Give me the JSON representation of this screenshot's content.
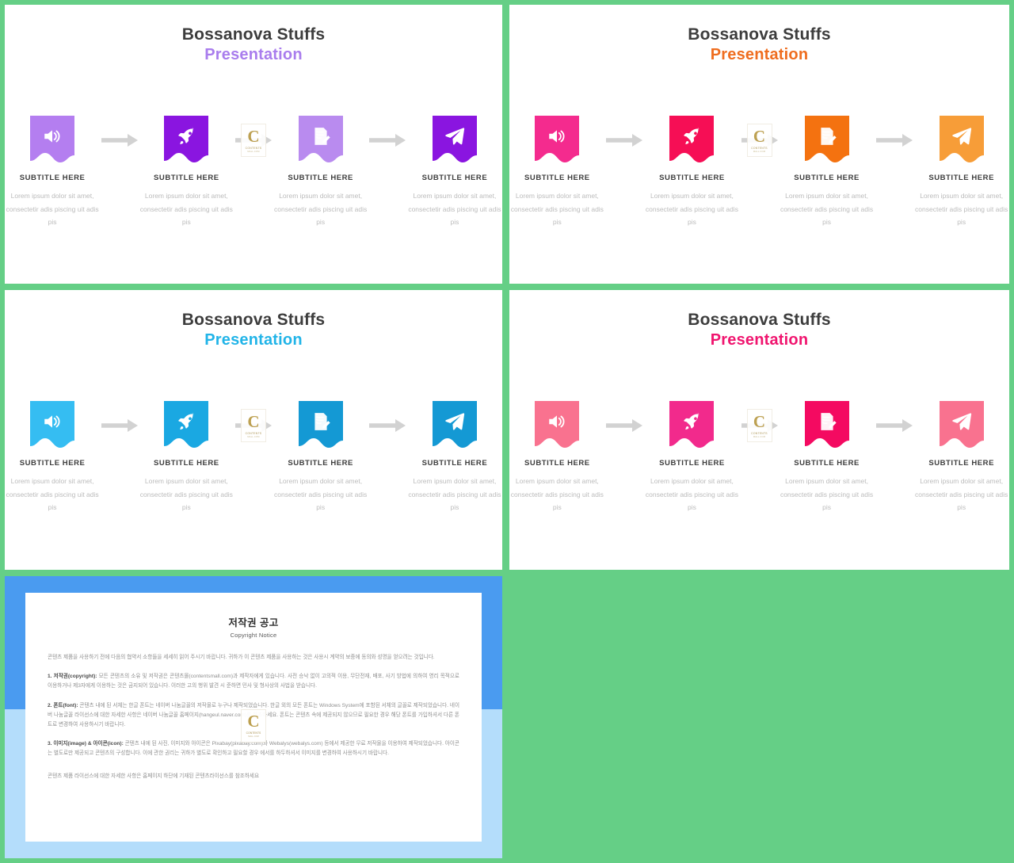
{
  "background_color": "#65cf86",
  "slides": [
    {
      "id": "slide-1",
      "title_line1": "Bossanova Stuffs",
      "title_line2": "Presentation",
      "accent": "#a97ded",
      "ribbon_colors": [
        "#b47ef0",
        "#8a15e0",
        "#b98bef",
        "#8a15e0"
      ],
      "steps": [
        {
          "icon": "speaker-icon",
          "title": "SUBTITLE HERE",
          "body": "Lorem ipsum dolor sit amet, consectetir adis piscing uit adis pis"
        },
        {
          "icon": "rocket-icon",
          "title": "SUBTITLE HERE",
          "body": "Lorem ipsum dolor sit amet, consectetir adis piscing uit adis pis"
        },
        {
          "icon": "note-edit-icon",
          "title": "SUBTITLE HERE",
          "body": "Lorem ipsum dolor sit amet, consectetir adis piscing uit adis pis"
        },
        {
          "icon": "paper-plane-icon",
          "title": "SUBTITLE HERE",
          "body": "Lorem ipsum dolor sit amet, consectetir adis piscing uit adis pis"
        }
      ]
    },
    {
      "id": "slide-2",
      "title_line1": "Bossanova Stuffs",
      "title_line2": "Presentation",
      "accent": "#ef6d1f",
      "ribbon_colors": [
        "#f42b8e",
        "#f60e55",
        "#f47210",
        "#f79d38"
      ],
      "steps": [
        {
          "icon": "speaker-icon",
          "title": "SUBTITLE HERE",
          "body": "Lorem ipsum dolor sit amet, consectetir adis piscing uit adis pis"
        },
        {
          "icon": "rocket-icon",
          "title": "SUBTITLE HERE",
          "body": "Lorem ipsum dolor sit amet, consectetir adis piscing uit adis pis"
        },
        {
          "icon": "note-edit-icon",
          "title": "SUBTITLE HERE",
          "body": "Lorem ipsum dolor sit amet, consectetir adis piscing uit adis pis"
        },
        {
          "icon": "paper-plane-icon",
          "title": "SUBTITLE HERE",
          "body": "Lorem ipsum dolor sit amet, consectetir adis piscing uit adis pis"
        }
      ]
    },
    {
      "id": "slide-3",
      "title_line1": "Bossanova Stuffs",
      "title_line2": "Presentation",
      "accent": "#21b4e8",
      "ribbon_colors": [
        "#35bdf2",
        "#1aa8e2",
        "#1499d4",
        "#1499d4"
      ],
      "steps": [
        {
          "icon": "speaker-icon",
          "title": "SUBTITLE HERE",
          "body": "Lorem ipsum dolor sit amet, consectetir adis piscing uit adis pis"
        },
        {
          "icon": "rocket-icon",
          "title": "SUBTITLE HERE",
          "body": "Lorem ipsum dolor sit amet, consectetir adis piscing uit adis pis"
        },
        {
          "icon": "note-edit-icon",
          "title": "SUBTITLE HERE",
          "body": "Lorem ipsum dolor sit amet, consectetir adis piscing uit adis pis"
        },
        {
          "icon": "paper-plane-icon",
          "title": "SUBTITLE HERE",
          "body": "Lorem ipsum dolor sit amet, consectetir adis piscing uit adis pis"
        }
      ]
    },
    {
      "id": "slide-4",
      "title_line1": "Bossanova Stuffs",
      "title_line2": "Presentation",
      "accent": "#f0156f",
      "ribbon_colors": [
        "#f9728f",
        "#f22a8c",
        "#f40a61",
        "#f9728f"
      ],
      "steps": [
        {
          "icon": "speaker-icon",
          "title": "SUBTITLE HERE",
          "body": "Lorem ipsum dolor sit amet, consectetir adis piscing uit adis pis"
        },
        {
          "icon": "rocket-icon",
          "title": "SUBTITLE HERE",
          "body": "Lorem ipsum dolor sit amet, consectetir adis piscing uit adis pis"
        },
        {
          "icon": "note-edit-icon",
          "title": "SUBTITLE HERE",
          "body": "Lorem ipsum dolor sit amet, consectetir adis piscing uit adis pis"
        },
        {
          "icon": "paper-plane-icon",
          "title": "SUBTITLE HERE",
          "body": "Lorem ipsum dolor sit amet, consectetir adis piscing uit adis pis"
        }
      ]
    }
  ],
  "watermark": {
    "letter": "C",
    "line1": "CONTENTS",
    "line2": "MALL.COM"
  },
  "copyright": {
    "frame_color_top": "#4a9bf0",
    "frame_color_bottom": "#b4ddfb",
    "title_ko": "저작권 공고",
    "title_en": "Copyright Notice",
    "intro": "콘텐츠 제품을 사용하기 전에 다음의 협약서 소항들을 세세히 읽어 주시기 바랍니다. 귀하가 이 콘텐츠 제품을 사용하는 것은 사용시 계약의 보증에 동의와 성명을 얻으려는 것입니다.",
    "section1_label": "1. 저작권(copyright):",
    "section1": " 모든 콘텐츠의 소유 및 저작권은 콘텐츠몰(contentsmall.com)과 제작자에게 있습니다. 사전 승낙 없이 고의적 이용, 무단전재, 배포, 사기 방법에 의하여 영리 목적으로 이용하거나 제3자에게 이용하는 것은 금지되어 있습니다. 이러한 고의 행위 발견 시 준하면 민사 및 형사상의 사법을 받습니다.",
    "section2_label": "2. 폰트(font):",
    "section2": " 콘텐츠 내에 된 서체는 한글 폰트는 네이버 나눔글꼴의 저작물로 누구나 제작되었습니다. 한글 외의 모든 폰트는 Windows System에 포함된 서체의 글꼴로 제작되었습니다. 네이버 나눔글꼴 라이선스에 대한 자세한 사항은 네이버 나눔글꼴 홈페이지(hangeul.naver.com)를 참조하세요. 폰트는 콘텐츠 속에 제공되지 않으므로 필요한 경우 해당 폰트를 가입하셔서 다른 폰트로 변경하여 사용하시기 바랍니다.",
    "section3_label": "3. 이미지(image) & 아이콘(icon):",
    "section3": " 콘텐츠 내에 된 사진, 이미지와 아이콘은 Pixabay(pixabay.com)와 Webalys(webalys.com) 등에서 제공한 무료 저작물을 이용하여 제작되었습니다. 아이콘는 별도로만 제공되고 콘텐츠의 구성합니다. 이에 관한 권리는 귀하가 별도로 확인하고 필요할 경우 에서를 하두하셔서 이미지를 변경하여 사용하시기 바랍니다.",
    "footer": "콘텐츠 제품 라이선스에 대한 자세한 사항은 홈페이지 하단에 기재된 콘텐츠라이선스를 참조하세요"
  }
}
